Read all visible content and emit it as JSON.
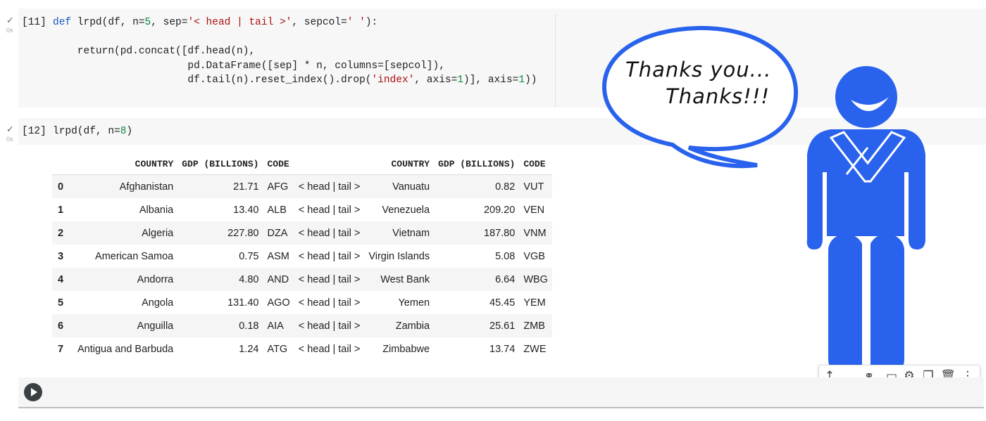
{
  "cell11": {
    "check": "✓",
    "time": "0s",
    "prompt": "[11]",
    "line1_kw": "def",
    "line1_a": " lrpd(df, n=",
    "line1_num": "5",
    "line1_b": ", sep=",
    "line1_str1": "'< head | tail >'",
    "line1_c": ", sepcol=",
    "line1_str2": "' '",
    "line1_d": "):",
    "line2": "    return(pd.concat([df.head(n),",
    "line3": "                      pd.DataFrame([sep] * n, columns=[sepcol]),",
    "line4_a": "                      df.tail(n).reset_index().drop(",
    "line4_str": "'index'",
    "line4_b": ", axis=",
    "line4_num1": "1",
    "line4_c": ")], axis=",
    "line4_num2": "1",
    "line4_d": "))"
  },
  "cell12": {
    "check": "✓",
    "time": "0s",
    "prompt": "[12]",
    "code_a": "lrpd(df, n=",
    "code_num": "8",
    "code_b": ")"
  },
  "table": {
    "headers": [
      "",
      "COUNTRY",
      "GDP (BILLIONS)",
      "CODE",
      "",
      "COUNTRY",
      "GDP (BILLIONS)",
      "CODE"
    ],
    "rows": [
      [
        "0",
        "Afghanistan",
        "21.71",
        "AFG",
        "< head | tail >",
        "Vanuatu",
        "0.82",
        "VUT"
      ],
      [
        "1",
        "Albania",
        "13.40",
        "ALB",
        "< head | tail >",
        "Venezuela",
        "209.20",
        "VEN"
      ],
      [
        "2",
        "Algeria",
        "227.80",
        "DZA",
        "< head | tail >",
        "Vietnam",
        "187.80",
        "VNM"
      ],
      [
        "3",
        "American Samoa",
        "0.75",
        "ASM",
        "< head | tail >",
        "Virgin Islands",
        "5.08",
        "VGB"
      ],
      [
        "4",
        "Andorra",
        "4.80",
        "AND",
        "< head | tail >",
        "West Bank",
        "6.64",
        "WBG"
      ],
      [
        "5",
        "Angola",
        "131.40",
        "AGO",
        "< head | tail >",
        "Yemen",
        "45.45",
        "YEM"
      ],
      [
        "6",
        "Anguilla",
        "0.18",
        "AIA",
        "< head | tail >",
        "Zambia",
        "25.61",
        "ZMB"
      ],
      [
        "7",
        "Antigua and Barbuda",
        "1.24",
        "ATG",
        "< head | tail >",
        "Zimbabwe",
        "13.74",
        "ZWE"
      ]
    ]
  },
  "bubble": {
    "line1": "Thanks you...",
    "line2": "Thanks!!!"
  },
  "toolbar": {
    "icons": [
      "arrow-up-icon",
      "link-icon",
      "comment-icon",
      "gear-icon",
      "mirror-cell-icon",
      "trash-icon",
      "more-vert-icon"
    ]
  },
  "colors": {
    "figure": "#2962ec",
    "keyword": "#1a5bc0",
    "number": "#0b8a3e",
    "string": "#a11111"
  }
}
